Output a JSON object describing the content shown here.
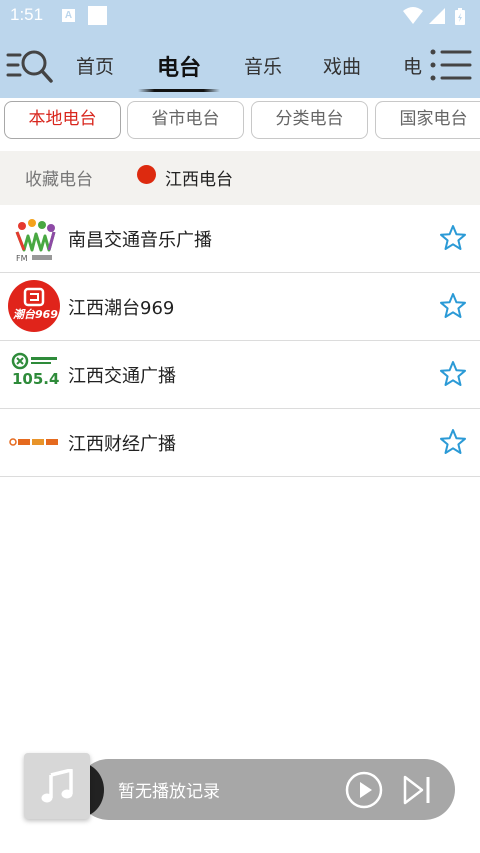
{
  "status_bar": {
    "time": "1:51",
    "notification_letter": "A"
  },
  "top_nav": {
    "tabs": [
      {
        "label": "首页",
        "active": false
      },
      {
        "label": "电台",
        "active": true
      },
      {
        "label": "音乐",
        "active": false
      },
      {
        "label": "戏曲",
        "active": false
      },
      {
        "label": "电",
        "active": false
      }
    ]
  },
  "sub_tabs": [
    {
      "label": "本地电台",
      "active": true
    },
    {
      "label": "省市电台",
      "active": false
    },
    {
      "label": "分类电台",
      "active": false
    },
    {
      "label": "国家电台",
      "active": false
    }
  ],
  "favorites": {
    "label": "收藏电台",
    "station": "江西电台"
  },
  "stations": [
    {
      "name": "南昌交通音乐广播",
      "logo": "fm-logo",
      "favorite": false
    },
    {
      "name": "江西潮台969",
      "logo": "chaotai-969-logo",
      "favorite": false
    },
    {
      "name": "江西交通广播",
      "logo": "jiaotong-1054-logo",
      "logo_text": "105.4",
      "favorite": false
    },
    {
      "name": "江西财经广播",
      "logo": "caijing-logo",
      "favorite": false
    }
  ],
  "player": {
    "status": "暂无播放记录"
  },
  "colors": {
    "header_bg": "#bcd6ec",
    "accent_red": "#d8261d",
    "star_blue": "#2b9ad6",
    "player_bg": "#a7a7a7"
  }
}
